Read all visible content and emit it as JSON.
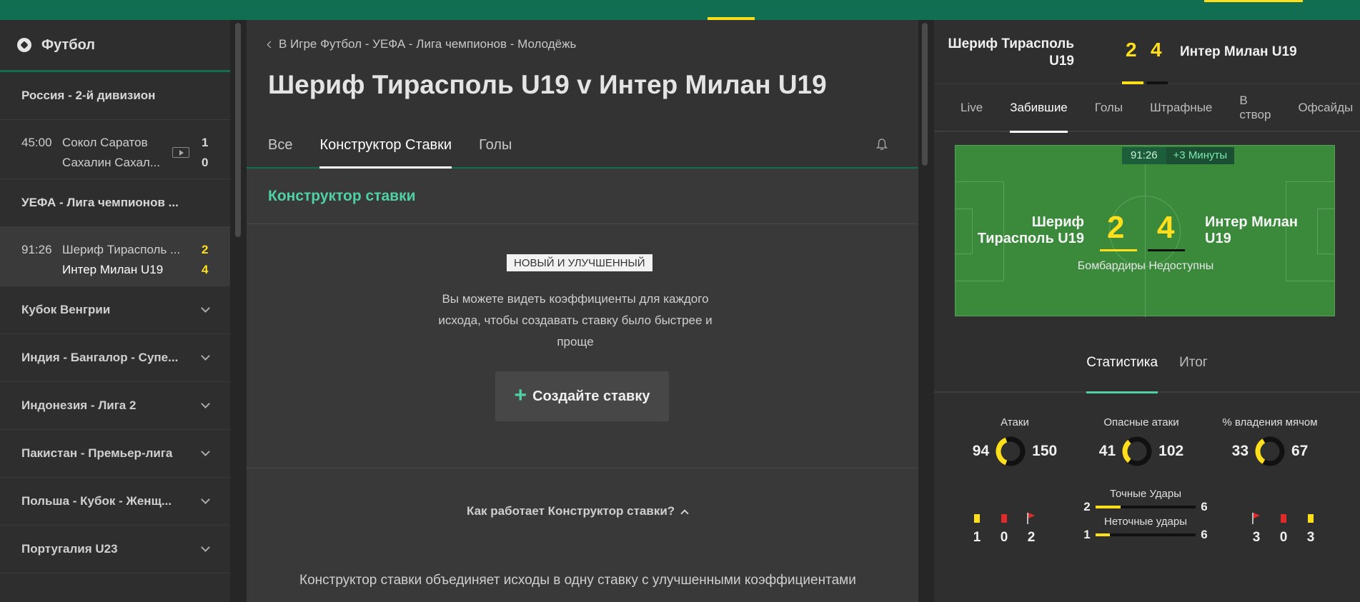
{
  "sidebar": {
    "title": "Футбол",
    "sections": [
      {
        "name": "Россия - 2-й дивизион",
        "matches": [
          {
            "time": "45:00",
            "home": "Сокол Саратов",
            "away": "Сахалин Сахал...",
            "home_score": "1",
            "away_score": "0",
            "has_video": true
          }
        ]
      },
      {
        "name": "УЕФА - Лига чемпионов ...",
        "matches": [
          {
            "time": "91:26",
            "home": "Шериф Тирасполь ...",
            "away": "Интер Милан U19",
            "home_score": "2",
            "away_score": "4",
            "has_video": false
          }
        ]
      }
    ],
    "leagues": [
      "Кубок Венгрии",
      "Индия - Бангалор - Супе...",
      "Индонезия - Лига 2",
      "Пакистан - Премьер-лига",
      "Польша - Кубок - Женщ...",
      "Португалия U23"
    ]
  },
  "main": {
    "breadcrumb": "В Игре Футбол - УЕФА - Лига чемпионов - Молодёжь",
    "title": "Шериф Тирасполь U19 v Интер Милан U19",
    "tabs": [
      "Все",
      "Конструктор Ставки",
      "Голы"
    ],
    "active_tab": 1,
    "builder_heading": "Конструктор ставки",
    "badge": "НОВЫЙ И УЛУЧШЕННЫЙ",
    "description": "Вы можете видеть коэффициенты для каждого исхода, чтобы создавать ставку было быстрее и проще",
    "create_button": "Создайте ставку",
    "how_it_works": "Как работает Конструктор ставки?",
    "bottom_text": "Конструктор ставки объединяет исходы в одну ставку с улучшенными коэффициентами"
  },
  "scoreboard": {
    "home": "Шериф Тирасполь U19",
    "away": "Интер Милан U19",
    "home_score": "2",
    "away_score": "4",
    "tabs": [
      "Live",
      "Забившие",
      "Голы",
      "Штрафные",
      "В створ",
      "Офсайды"
    ],
    "active_tab": 1,
    "pitch": {
      "time": "91:26",
      "extra": "+3 Минуты",
      "home": "Шериф Тирасполь U19",
      "away": "Интер Милан U19",
      "scorers": "Бомбардиры Недоступны"
    },
    "summary_tabs": [
      "Статистика",
      "Итог"
    ],
    "summary_active": 0,
    "stats": [
      {
        "label": "Атаки",
        "home": "94",
        "away": "150",
        "home_value": 94,
        "away_value": 150
      },
      {
        "label": "Опасные атаки",
        "home": "41",
        "away": "102",
        "home_value": 41,
        "away_value": 102
      },
      {
        "label": "% владения мячом",
        "home": "33",
        "away": "67",
        "home_value": 33,
        "away_value": 67
      }
    ],
    "home_cards": {
      "yellow": "1",
      "red": "0",
      "corners": "2"
    },
    "away_cards": {
      "corners": "3",
      "red": "0",
      "yellow": "3"
    },
    "shots_on_target": {
      "label": "Точные Удары",
      "home": "2",
      "away": "6",
      "home_value": 2,
      "away_value": 6
    },
    "shots_off_target": {
      "label": "Неточные удары",
      "home": "1",
      "away": "6",
      "home_value": 1,
      "away_value": 6
    },
    "colors": {
      "home": "#ffdf1b",
      "away": "#111111",
      "accent": "#4fd1a5",
      "brand": "#126e51"
    }
  }
}
